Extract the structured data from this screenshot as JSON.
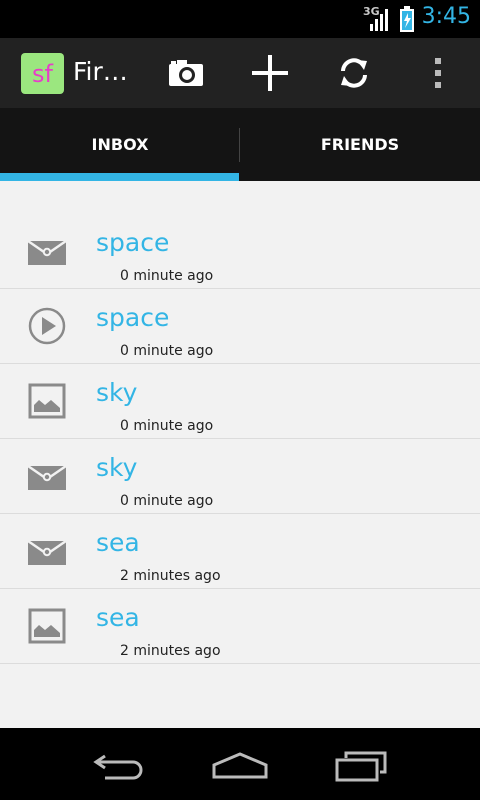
{
  "status_bar": {
    "network": "3G",
    "time": "3:45",
    "clock_color": "#33b5e5"
  },
  "action_bar": {
    "app_icon_text": "sf",
    "title": "Fir…",
    "actions": [
      "camera-icon",
      "add-icon",
      "refresh-icon",
      "overflow-menu-icon"
    ]
  },
  "tabs": [
    {
      "label": "INBOX",
      "selected": true
    },
    {
      "label": "FRIENDS",
      "selected": false
    }
  ],
  "accent_color": "#33b5e5",
  "messages": [
    {
      "title": "space",
      "time": "0 minute ago",
      "icon": "envelope-icon"
    },
    {
      "title": "space",
      "time": "0 minute ago",
      "icon": "play-icon"
    },
    {
      "title": "sky",
      "time": "0 minute ago",
      "icon": "image-icon"
    },
    {
      "title": "sky",
      "time": "0 minute ago",
      "icon": "envelope-icon"
    },
    {
      "title": "sea",
      "time": "2 minutes ago",
      "icon": "envelope-icon"
    },
    {
      "title": "sea",
      "time": "2 minutes ago",
      "icon": "image-icon"
    }
  ],
  "nav_bar": {
    "buttons": [
      "back-icon",
      "home-icon",
      "recent-apps-icon"
    ]
  }
}
